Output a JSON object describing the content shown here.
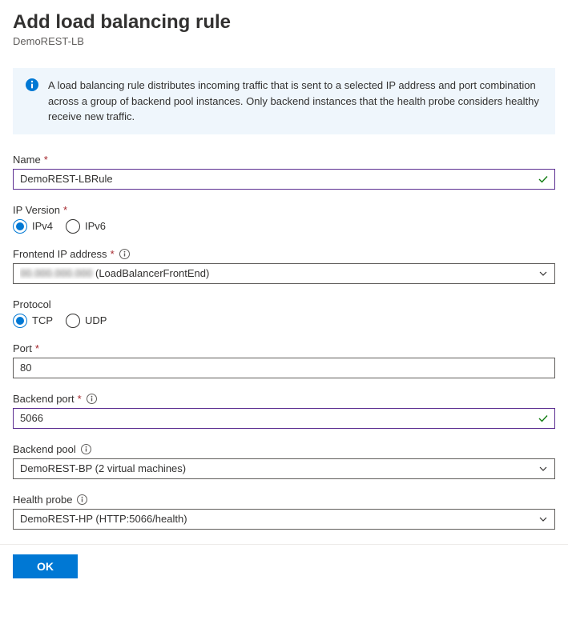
{
  "header": {
    "title": "Add load balancing rule",
    "subtitle": "DemoREST-LB"
  },
  "info_banner": {
    "text": "A load balancing rule distributes incoming traffic that is sent to a selected IP address and port combination across a group of backend pool instances. Only backend instances that the health probe considers healthy receive new traffic."
  },
  "form": {
    "name": {
      "label": "Name",
      "value": "DemoREST-LBRule"
    },
    "ip_version": {
      "label": "IP Version",
      "options": {
        "ipv4": "IPv4",
        "ipv6": "IPv6"
      },
      "selected": "ipv4"
    },
    "frontend_ip": {
      "label": "Frontend IP address",
      "value_suffix": " (LoadBalancerFrontEnd)"
    },
    "protocol": {
      "label": "Protocol",
      "options": {
        "tcp": "TCP",
        "udp": "UDP"
      },
      "selected": "tcp"
    },
    "port": {
      "label": "Port",
      "value": "80"
    },
    "backend_port": {
      "label": "Backend port",
      "value": "5066"
    },
    "backend_pool": {
      "label": "Backend pool",
      "value": "DemoREST-BP (2 virtual machines)"
    },
    "health_probe": {
      "label": "Health probe",
      "value": "DemoREST-HP (HTTP:5066/health)"
    }
  },
  "footer": {
    "ok_label": "OK"
  }
}
